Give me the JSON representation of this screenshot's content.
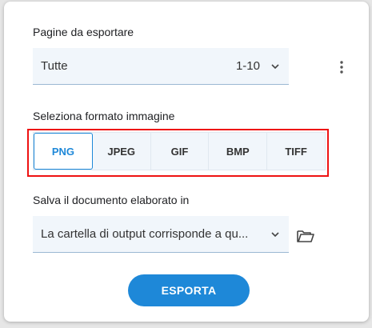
{
  "pages_section": {
    "label": "Pagine da esportare",
    "select_value": "Tutte",
    "range": "1-10"
  },
  "format_section": {
    "label": "Seleziona formato immagine",
    "formats": [
      "PNG",
      "JPEG",
      "GIF",
      "BMP",
      "TIFF"
    ],
    "selected": "PNG"
  },
  "save_section": {
    "label": "Salva il documento elaborato in",
    "select_value": "La cartella di output corrisponde a qu..."
  },
  "export_button": {
    "label": "ESPORTA"
  },
  "colors": {
    "accent": "#1e88d8",
    "highlight": "#ee1111",
    "field_bg": "#f1f6fb"
  },
  "icons": [
    "chevron-down-icon",
    "more-vert-icon",
    "folder-open-icon"
  ]
}
